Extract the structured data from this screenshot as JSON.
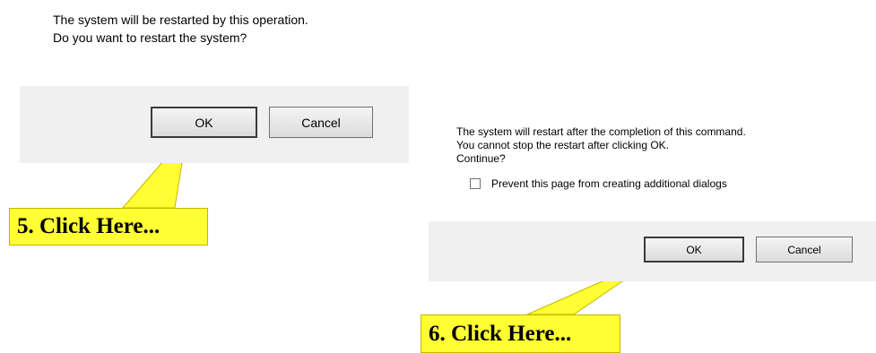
{
  "dialog1": {
    "message_lines": [
      "The system will be restarted by this operation.",
      "Do you want to restart the system?"
    ],
    "ok_label": "OK",
    "cancel_label": "Cancel"
  },
  "dialog2": {
    "message_lines": [
      "The system will restart after the completion of this command.",
      "You cannot stop the restart after clicking OK.",
      "Continue?"
    ],
    "checkbox_label": "Prevent this page from creating additional dialogs",
    "checkbox_checked": false,
    "ok_label": "OK",
    "cancel_label": "Cancel"
  },
  "callouts": [
    {
      "text": "5. Click Here..."
    },
    {
      "text": "6. Click Here..."
    }
  ],
  "colors": {
    "callout_fill": "#ffff33",
    "button_bar": "#f0f0f0"
  }
}
